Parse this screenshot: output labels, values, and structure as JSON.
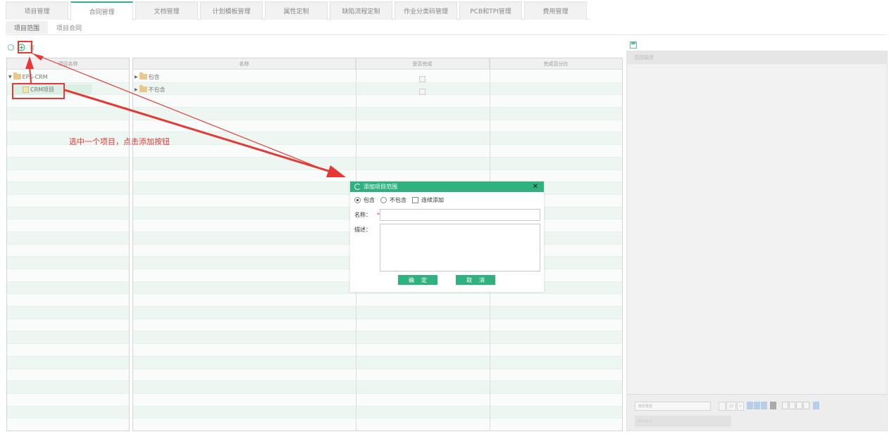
{
  "top_tabs": [
    "项目管理",
    "合同管理",
    "文档管理",
    "计划模板管理",
    "属性定制",
    "缺陷流程定制",
    "作业分类码管理",
    "PCB和TPI管理",
    "费用管理"
  ],
  "active_top_tab": "合同管理",
  "sub_tabs": [
    "项目范围",
    "项目合同"
  ],
  "toolbar": {
    "icons": [
      "refresh-icon",
      "add-icon",
      "delete-icon"
    ]
  },
  "tree_panel": {
    "header": "项目名称",
    "nodes": [
      {
        "label": "EPS-CRM",
        "type": "folder",
        "expanded": true
      },
      {
        "label": "CRM项目",
        "type": "project",
        "selected": true
      }
    ]
  },
  "grid": {
    "columns": [
      "名称",
      "是否完成",
      "完成百分比"
    ],
    "rows": [
      {
        "name": "包含",
        "done": false,
        "percent": ""
      },
      {
        "name": "不包含",
        "done": false,
        "percent": ""
      }
    ]
  },
  "right_panel": {
    "header": "范围描述",
    "font_placeholder": "微软雅黑",
    "font_size": "12",
    "status_placeholder": "Words:0"
  },
  "annotation": {
    "text": "选中一个项目，点击添加按钮"
  },
  "dialog": {
    "title": "添加项目范围",
    "options": {
      "include": "包含",
      "exclude": "不包含",
      "continuous": "连续添加"
    },
    "name_label": "名称：",
    "required_mark": "*",
    "desc_label": "描述：",
    "ok": "确定",
    "cancel": "取消"
  },
  "colors": {
    "accent": "#2fb27f",
    "annotation": "#e53935"
  }
}
